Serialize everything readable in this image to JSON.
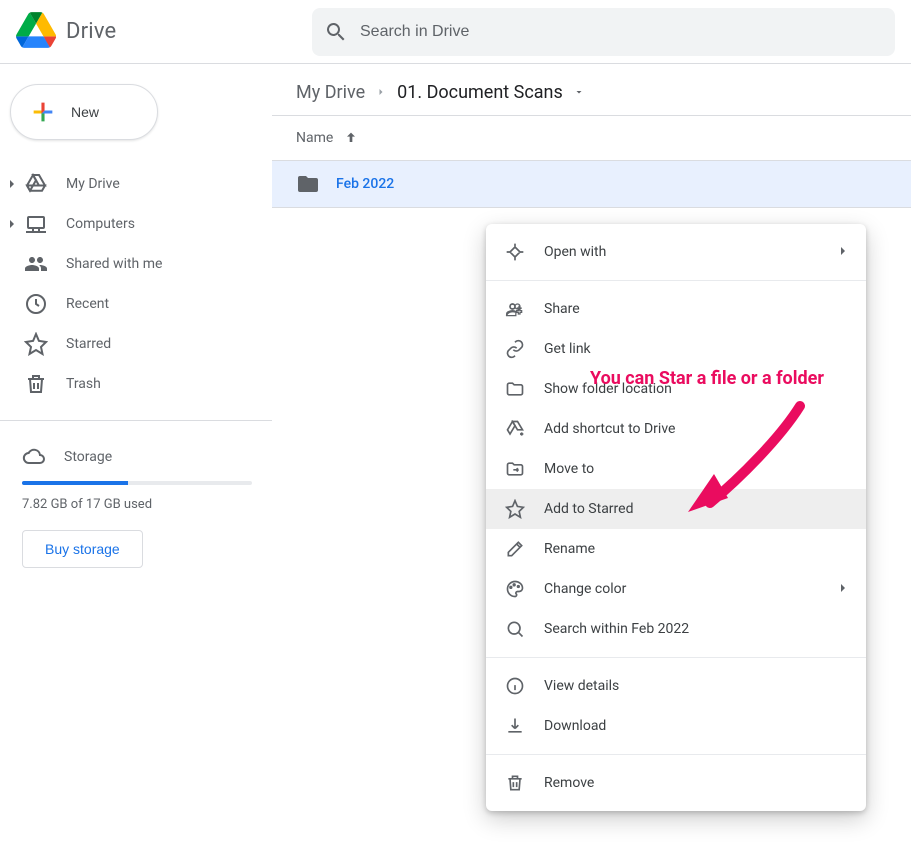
{
  "app": {
    "name": "Drive"
  },
  "search": {
    "placeholder": "Search in Drive"
  },
  "newButton": {
    "label": "New"
  },
  "sidebar": {
    "items": [
      {
        "label": "My Drive"
      },
      {
        "label": "Computers"
      },
      {
        "label": "Shared with me"
      },
      {
        "label": "Recent"
      },
      {
        "label": "Starred"
      },
      {
        "label": "Trash"
      }
    ],
    "storage": {
      "label": "Storage",
      "used_text": "7.82 GB of 17 GB used",
      "used_percent": 46,
      "buy_label": "Buy storage"
    }
  },
  "breadcrumb": {
    "root": "My Drive",
    "current": "01. Document Scans"
  },
  "list": {
    "header": "Name",
    "rows": [
      {
        "name": "Feb 2022"
      }
    ]
  },
  "contextMenu": {
    "open_with": "Open with",
    "share": "Share",
    "get_link": "Get link",
    "show_folder": "Show folder location",
    "add_shortcut": "Add shortcut to Drive",
    "move_to": "Move to",
    "add_starred": "Add to Starred",
    "rename": "Rename",
    "change_color": "Change color",
    "search_within": "Search within Feb 2022",
    "view_details": "View details",
    "download": "Download",
    "remove": "Remove"
  },
  "annotation": {
    "text": "You can Star a file or a folder"
  }
}
